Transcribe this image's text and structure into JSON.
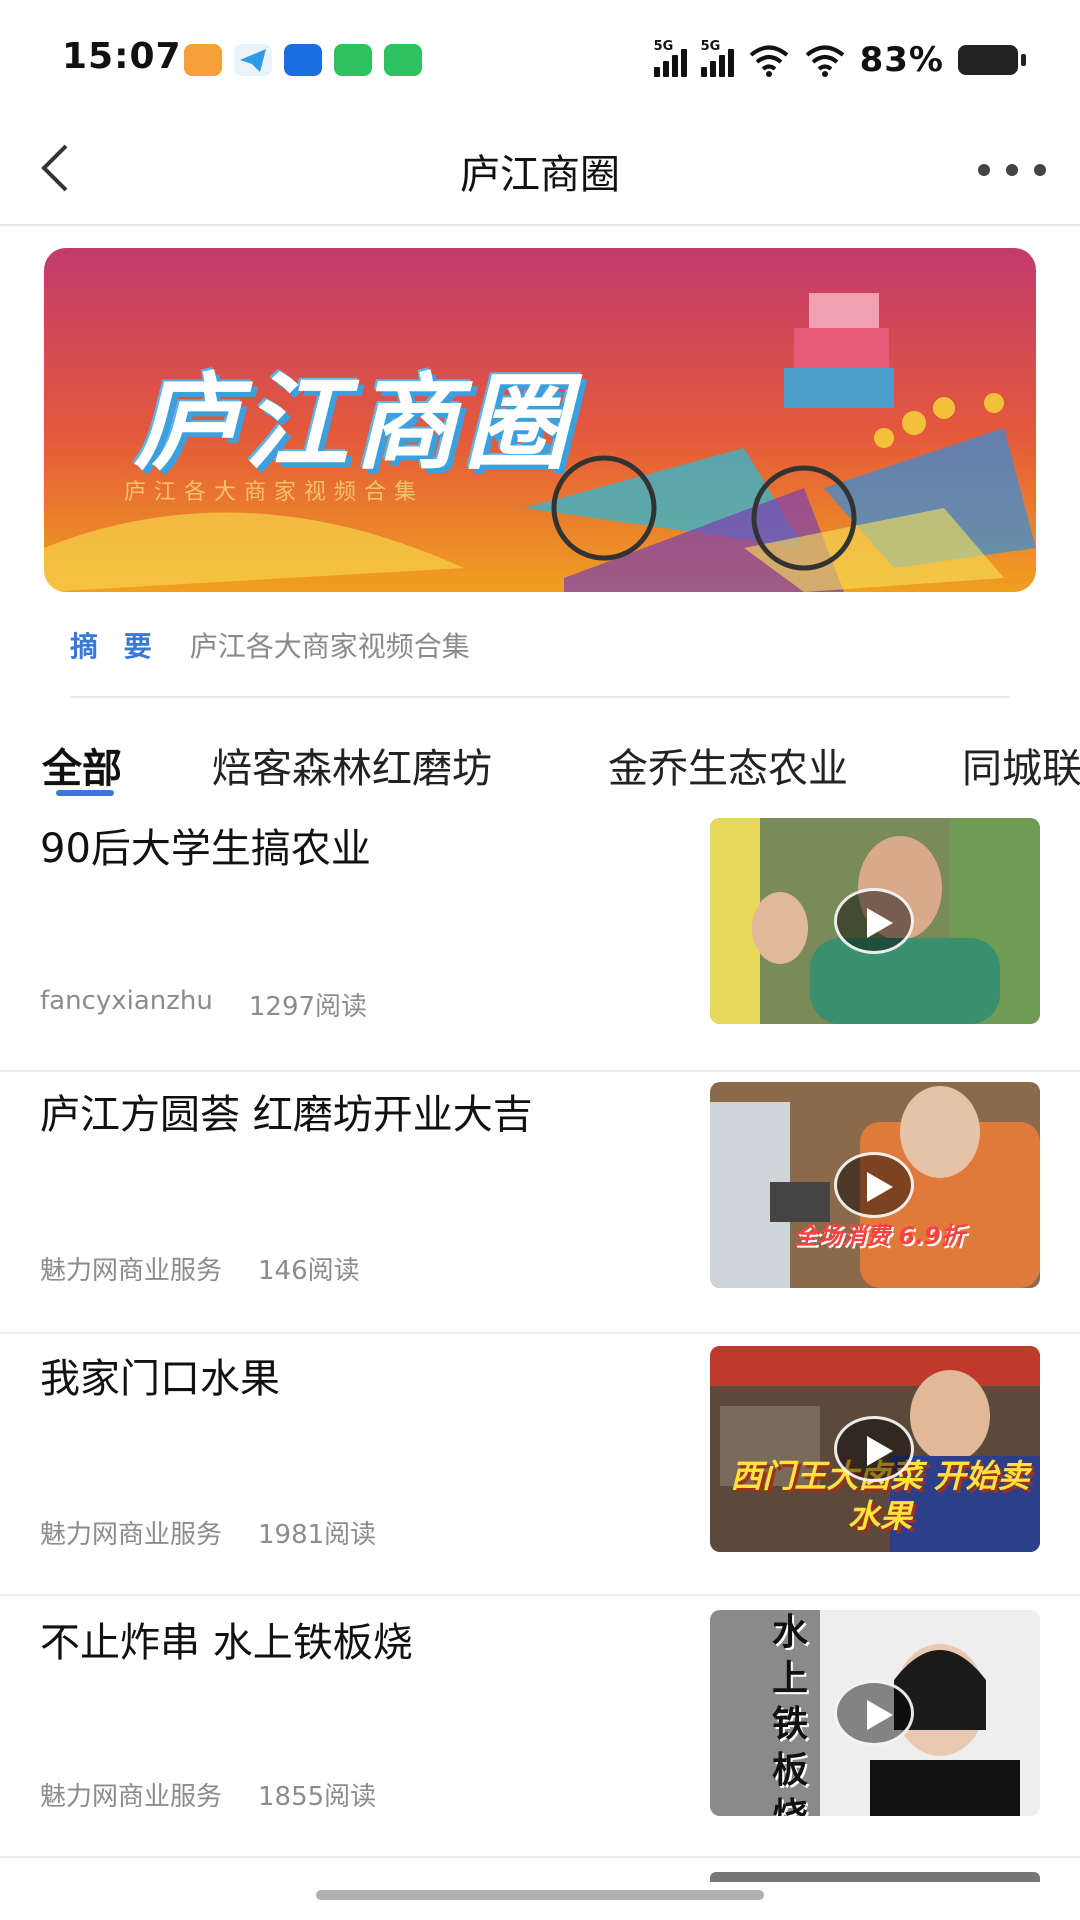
{
  "status_bar": {
    "time": "15:07",
    "signal_1_label": "5G",
    "signal_2_label": "5G",
    "battery": "83%",
    "app_icon_colors": [
      "#f5a03a",
      "#2f9be6",
      "#1c6fe0",
      "#2dc25d",
      "#2dc25d"
    ]
  },
  "header": {
    "title": "庐江商圈",
    "back_icon": "chevron-left-icon",
    "more_icon": "more-dots-icon"
  },
  "banner": {
    "title": "庐江商圈",
    "subtitle": "庐江各大商家视频合集"
  },
  "summary": {
    "label": "摘 要",
    "text": "庐江各大商家视频合集"
  },
  "tabs": [
    {
      "label": "全部",
      "active": true
    },
    {
      "label": "焙客森林红磨坊",
      "active": false
    },
    {
      "label": "金乔生态农业",
      "active": false
    },
    {
      "label": "同城联",
      "active": false
    }
  ],
  "articles": [
    {
      "title": "90后大学生搞农业",
      "author": "fancyxianzhu",
      "reads": "1297阅读",
      "caption": ""
    },
    {
      "title": "庐江方圆荟 红磨坊开业大吉",
      "author": "魅力网商业服务",
      "reads": "146阅读",
      "caption": "全场消费 6.9折"
    },
    {
      "title": "我家门口水果",
      "author": "魅力网商业服务",
      "reads": "1981阅读",
      "caption": "西门王大卤菜 开始卖水果"
    },
    {
      "title": "不止炸串 水上铁板烧",
      "author": "魅力网商业服务",
      "reads": "1855阅读",
      "caption": "水上铁板烧"
    }
  ],
  "colors": {
    "accent": "#3a78d4",
    "banner_top": "#c23a6e",
    "banner_bottom": "#f0a020"
  }
}
